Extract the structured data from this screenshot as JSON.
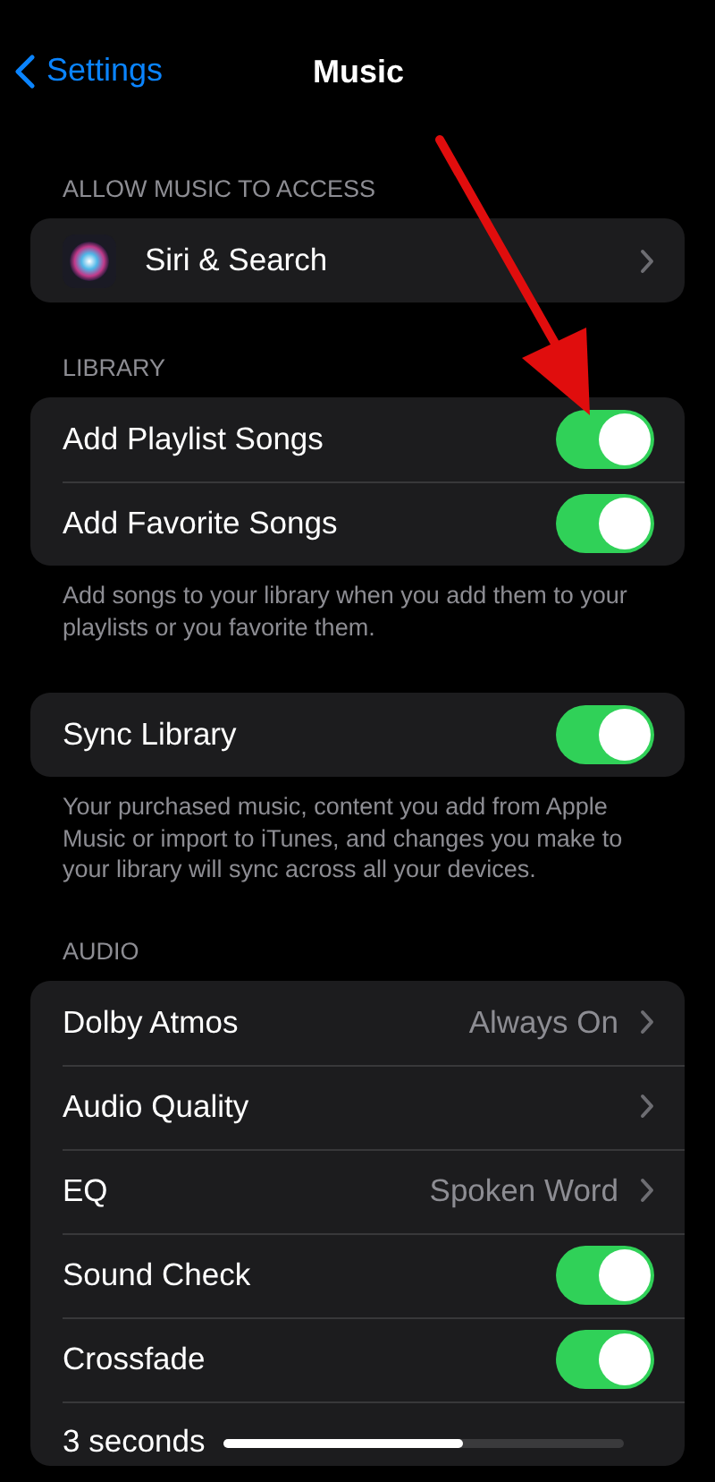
{
  "nav": {
    "back_label": "Settings",
    "title": "Music"
  },
  "sections": [
    {
      "header": "ALLOW MUSIC TO ACCESS",
      "rows": [
        {
          "kind": "app_link",
          "label": "Siri & Search"
        }
      ]
    },
    {
      "header": "LIBRARY",
      "rows": [
        {
          "kind": "toggle",
          "label": "Add Playlist Songs",
          "on": true
        },
        {
          "kind": "toggle",
          "label": "Add Favorite Songs",
          "on": true
        }
      ],
      "footer": "Add songs to your library when you add them to your playlists or you favorite them."
    },
    {
      "rows": [
        {
          "kind": "toggle",
          "label": "Sync Library",
          "on": true
        }
      ],
      "footer": "Your purchased music, content you add from Apple Music or import to iTunes, and changes you make to your library will sync across all your devices."
    },
    {
      "header": "AUDIO",
      "rows": [
        {
          "kind": "link",
          "label": "Dolby Atmos",
          "value": "Always On"
        },
        {
          "kind": "link",
          "label": "Audio Quality"
        },
        {
          "kind": "link",
          "label": "EQ",
          "value": "Spoken Word"
        },
        {
          "kind": "toggle",
          "label": "Sound Check",
          "on": true
        },
        {
          "kind": "toggle",
          "label": "Crossfade",
          "on": true
        },
        {
          "kind": "slider",
          "label": "3 seconds",
          "level": 0.6
        }
      ]
    }
  ]
}
